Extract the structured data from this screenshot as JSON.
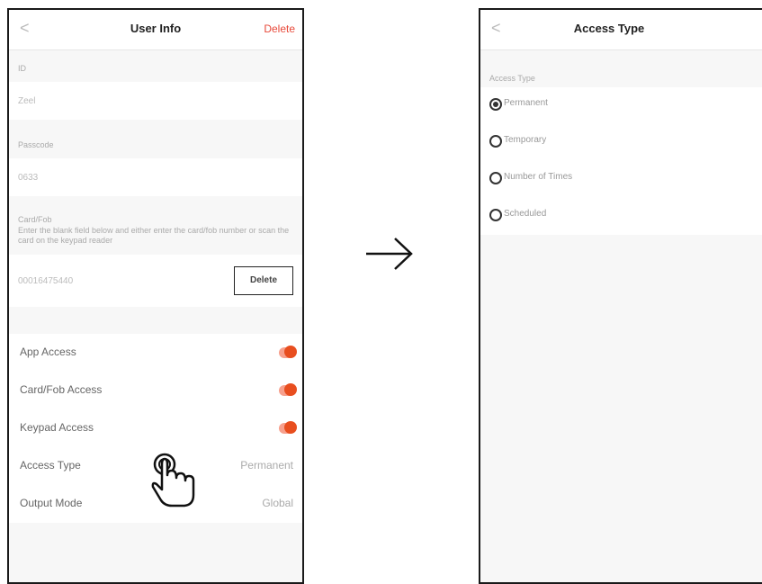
{
  "left_screen": {
    "header": {
      "back": "<",
      "title": "User Info",
      "delete_label": "Delete"
    },
    "id": {
      "label": "ID",
      "value": "Zeel"
    },
    "passcode": {
      "label": "Passcode",
      "value": "0633"
    },
    "card_fob": {
      "label": "Card/Fob",
      "hint": "Enter the blank field below and either enter the card/fob number or scan the card on the keypad reader",
      "value": "00016475440",
      "delete_label": "Delete"
    },
    "rows": [
      {
        "label": "App Access",
        "toggle": "on"
      },
      {
        "label": "Card/Fob Access",
        "toggle": "on"
      },
      {
        "label": "Keypad Access",
        "toggle": "on"
      }
    ],
    "access_type": {
      "label": "Access Type",
      "value": "Permanent"
    },
    "output_mode": {
      "label": "Output Mode",
      "value": "Global"
    },
    "accent_color": "#e8493a"
  },
  "arrow_icon": "right-arrow",
  "hand_icon": "tap-hand",
  "right_screen": {
    "header": {
      "back": "<",
      "title": "Access Type"
    },
    "section_label": "Access Type",
    "options": [
      {
        "label": "Permanent",
        "selected": true
      },
      {
        "label": "Temporary",
        "selected": false
      },
      {
        "label": "Number of Times",
        "selected": false
      },
      {
        "label": "Scheduled",
        "selected": false
      }
    ]
  }
}
